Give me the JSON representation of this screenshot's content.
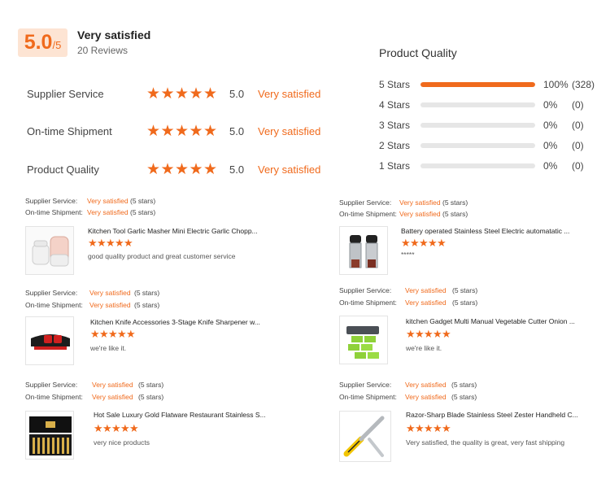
{
  "summary": {
    "score": "5.0",
    "score_suffix": "/5",
    "label": "Very satisfied",
    "review_count": "20 Reviews"
  },
  "metrics": [
    {
      "label": "Supplier Service",
      "value": "5.0",
      "text": "Very satisfied",
      "stars": 5
    },
    {
      "label": "On-time Shipment",
      "value": "5.0",
      "text": "Very satisfied",
      "stars": 5
    },
    {
      "label": "Product Quality",
      "value": "5.0",
      "text": "Very satisfied",
      "stars": 5
    }
  ],
  "product_quality": {
    "title": "Product Quality",
    "bars": [
      {
        "label": "5 Stars",
        "percent": "100%",
        "count": "(328)",
        "fill": 1.0
      },
      {
        "label": "4 Stars",
        "percent": "0%",
        "count": "(0)",
        "fill": 0
      },
      {
        "label": "3 Stars",
        "percent": "0%",
        "count": "(0)",
        "fill": 0
      },
      {
        "label": "2 Stars",
        "percent": "0%",
        "count": "(0)",
        "fill": 0
      },
      {
        "label": "1 Stars",
        "percent": "0%",
        "count": "(0)",
        "fill": 0
      }
    ]
  },
  "reviews": [
    {
      "supplier_label": "Supplier Service:",
      "supplier_value": "Very satisfied",
      "supplier_stars": "(5 stars)",
      "shipment_label": "On-time Shipment:",
      "shipment_value": "Very satisfied",
      "shipment_stars": "(5 stars)",
      "title": "Kitchen Tool Garlic Masher Mini Electric Garlic Chopp...",
      "comment": "good quality product and great customer service",
      "image": "garlic-chopper-image"
    },
    {
      "supplier_label": "Supplier Service:",
      "supplier_value": "Very satisfied",
      "supplier_stars": "(5 stars)",
      "shipment_label": "On-time Shipment:",
      "shipment_value": "Very satisfied",
      "shipment_stars": "(5 stars)",
      "title": "Battery operated Stainless Steel Electric automatatic ...",
      "comment": "*****",
      "image": "pepper-grinder-image"
    },
    {
      "supplier_label": "Supplier Service:",
      "supplier_value": "Very satisfied",
      "supplier_stars": "(5 stars)",
      "shipment_label": "On-time Shipment:",
      "shipment_value": "Very satisfied",
      "shipment_stars": "(5 stars)",
      "title": "Kitchen Knife Accessories 3-Stage Knife Sharpener w...",
      "comment": "we're like it.",
      "image": "knife-sharpener-image"
    },
    {
      "supplier_label": "Supplier Service:",
      "supplier_value": "Very satisfied",
      "supplier_stars": "(5 stars)",
      "shipment_label": "On-time Shipment:",
      "shipment_value": "Very satisfied",
      "shipment_stars": "(5 stars)",
      "title": "kitchen Gadget Multi Manual Vegetable Cutter Onion ...",
      "comment": "we're like it.",
      "image": "vegetable-cutter-image"
    },
    {
      "supplier_label": "Supplier Service:",
      "supplier_value": "Very satisfied",
      "supplier_stars": "(5 stars)",
      "shipment_label": "On-time Shipment:",
      "shipment_value": "Very satisfied",
      "shipment_stars": "(5 stars)",
      "title": "Hot Sale Luxury Gold Flatware Restaurant Stainless S...",
      "comment": "very nice products",
      "image": "gold-flatware-image"
    },
    {
      "supplier_label": "Supplier Service:",
      "supplier_value": "Very satisfied",
      "supplier_stars": "(5 stars)",
      "shipment_label": "On-time Shipment:",
      "shipment_value": "Very satisfied",
      "shipment_stars": "(5 stars)",
      "title": "Razor-Sharp Blade Stainless Steel Zester Handheld C...",
      "comment": "Very satisfied, the quality is great, very fast shipping",
      "image": "zester-image"
    }
  ],
  "colors": {
    "accent": "#f06a1c",
    "score_bg": "#fde4d3",
    "bar_track": "#e6e6e6"
  }
}
